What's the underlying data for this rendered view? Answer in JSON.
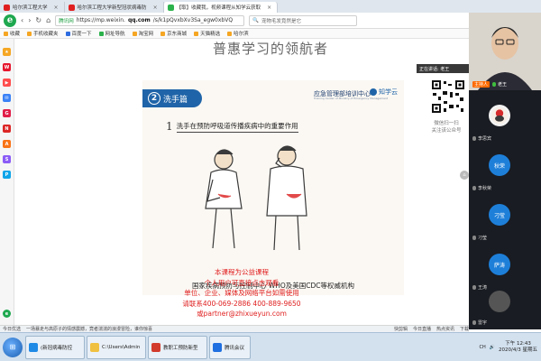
{
  "browser": {
    "tabs": [
      {
        "title": "哈尔滨工程大学",
        "active": false
      },
      {
        "title": "哈尔滨工程大学新型冠状病毒防",
        "active": false
      },
      {
        "title": "【取】收藏我，视频课程从知学云获取",
        "active": true
      }
    ],
    "back": "‹",
    "forward": "›",
    "refresh": "↻",
    "home": "⌂",
    "secure_label": "腾讯网",
    "url_prefix": "https://mp.weixin.",
    "url_host": "qq.com",
    "url_path": "/s/k1pQvxbXv3Sa_egw0xbVQ",
    "search_text": "宠物毛发竟然是它"
  },
  "bookmarks": [
    "收藏",
    "手机收藏夹",
    "百度一下",
    "网址导航",
    "淘宝网",
    "京东商城",
    "天猫精选",
    "哈尔滨"
  ],
  "page": {
    "title": "普惠学习的领航者",
    "slide": {
      "section_number": "2",
      "section_label": "洗手篇",
      "org_name": "应急管理部培训中心",
      "org_sub": "Training Center of Ministry of Emergency Management",
      "brand": "知学云",
      "point_number": "1",
      "point_text": "洗手在预防呼吸道传播疾病中的重要作用",
      "footer": "国家疾病预防与控制中心  WHO及美国CDC等权威机构"
    },
    "info_lines": [
      "本课程为公益课程",
      "个人用户可直接点击观看",
      "单位、企业、媒体及网络平台如需使用",
      "请联系400-069-2886    400-889-9650",
      "或partner@zhixueyun.com"
    ],
    "qr_caption_1": "微信扫一扫",
    "qr_caption_2": "关注该公众号"
  },
  "live_panel": {
    "speaking_label": "正在讲话: 老王",
    "host_tag": "主持人",
    "host_name": "老王",
    "participants": [
      {
        "name": "李思宾",
        "avatar_text": "",
        "color": "#e23b3b"
      },
      {
        "name": "李秋荣",
        "avatar_text": "秋荣",
        "color": "#1e7fd9"
      },
      {
        "name": "刁莹",
        "avatar_text": "刁莹",
        "color": "#1e7fd9"
      },
      {
        "name": "王涛",
        "avatar_text": "萨涛",
        "color": "#1e7fd9"
      },
      {
        "name": "雷宇",
        "avatar_text": "",
        "color": "#555555"
      }
    ]
  },
  "statusbar": {
    "left": "今日优选",
    "news": "一场暴走与高原子的情感震撼，竟者湍湍的浪漫冒险，谁你惊喜",
    "right_items": [
      "快剪辑",
      "今日直播",
      "热点资讯",
      "下载"
    ]
  },
  "taskbar": {
    "start_label": "⊞",
    "items": [
      {
        "label": "(新冠病毒防控",
        "color": "#1f8ae6"
      },
      {
        "label": "C:\\Users\\Admin",
        "color": "#f0c040"
      },
      {
        "label": "教职工预防新型",
        "color": "#d23b2c"
      },
      {
        "label": "腾讯会议",
        "color": "#1f6fe0"
      }
    ],
    "tray_icons": [
      "CH",
      "🔊"
    ],
    "time": "下午 12:43",
    "date": "2020/4/3 星期五"
  }
}
